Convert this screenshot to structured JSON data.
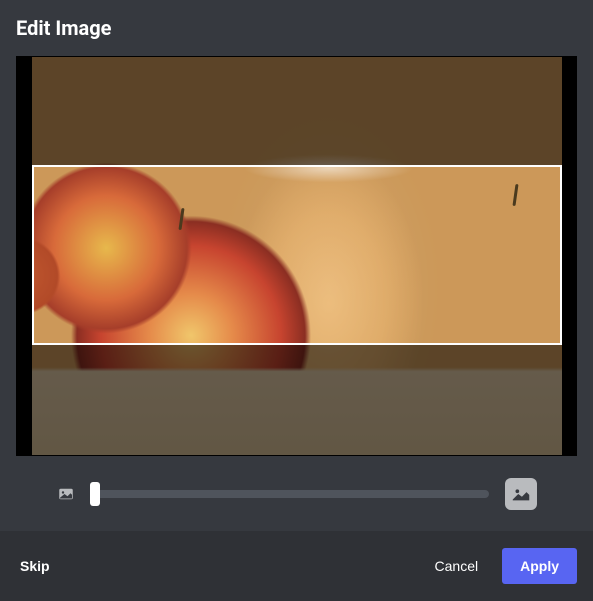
{
  "dialog": {
    "title": "Edit Image"
  },
  "slider": {
    "value": 0,
    "min": 0,
    "max": 100
  },
  "icons": {
    "zoom_small": "image-small-icon",
    "zoom_large": "image-large-icon"
  },
  "footer": {
    "skip_label": "Skip",
    "cancel_label": "Cancel",
    "apply_label": "Apply"
  },
  "colors": {
    "accent": "#5865f2",
    "bg": "#36393f",
    "footer_bg": "#2f3136",
    "track": "#4f545c",
    "thumb": "#ffffff"
  }
}
